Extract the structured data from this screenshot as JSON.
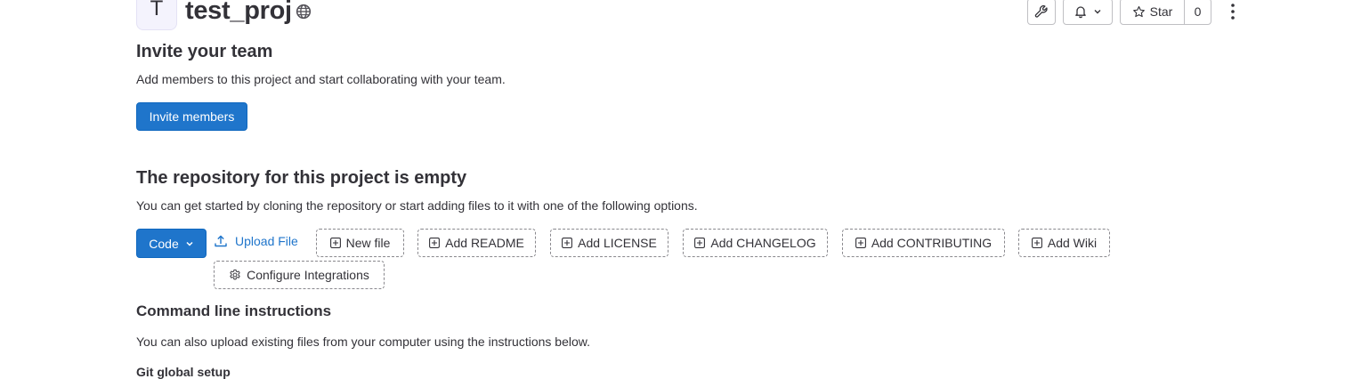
{
  "project": {
    "avatar_letter": "T",
    "name": "test_proj"
  },
  "header": {
    "star_label": "Star",
    "star_count": "0"
  },
  "invite": {
    "title": "Invite your team",
    "description": "Add members to this project and start collaborating with your team.",
    "button_label": "Invite members"
  },
  "empty_repo": {
    "title": "The repository for this project is empty",
    "description": "You can get started by cloning the repository or start adding files to it with one of the following options.",
    "code_button": "Code",
    "upload_file": "Upload File",
    "actions": {
      "new_file": "New file",
      "add_readme": "Add README",
      "add_license": "Add LICENSE",
      "add_changelog": "Add CHANGELOG",
      "add_contributing": "Add CONTRIBUTING",
      "add_wiki": "Add Wiki",
      "configure_integrations": "Configure Integrations"
    }
  },
  "cli": {
    "title": "Command line instructions",
    "description": "You can also upload existing files from your computer using the instructions below.",
    "git_global_setup": "Git global setup"
  },
  "colors": {
    "primary": "#1f75cb",
    "text": "#333238",
    "border": "#bfbfc3"
  }
}
